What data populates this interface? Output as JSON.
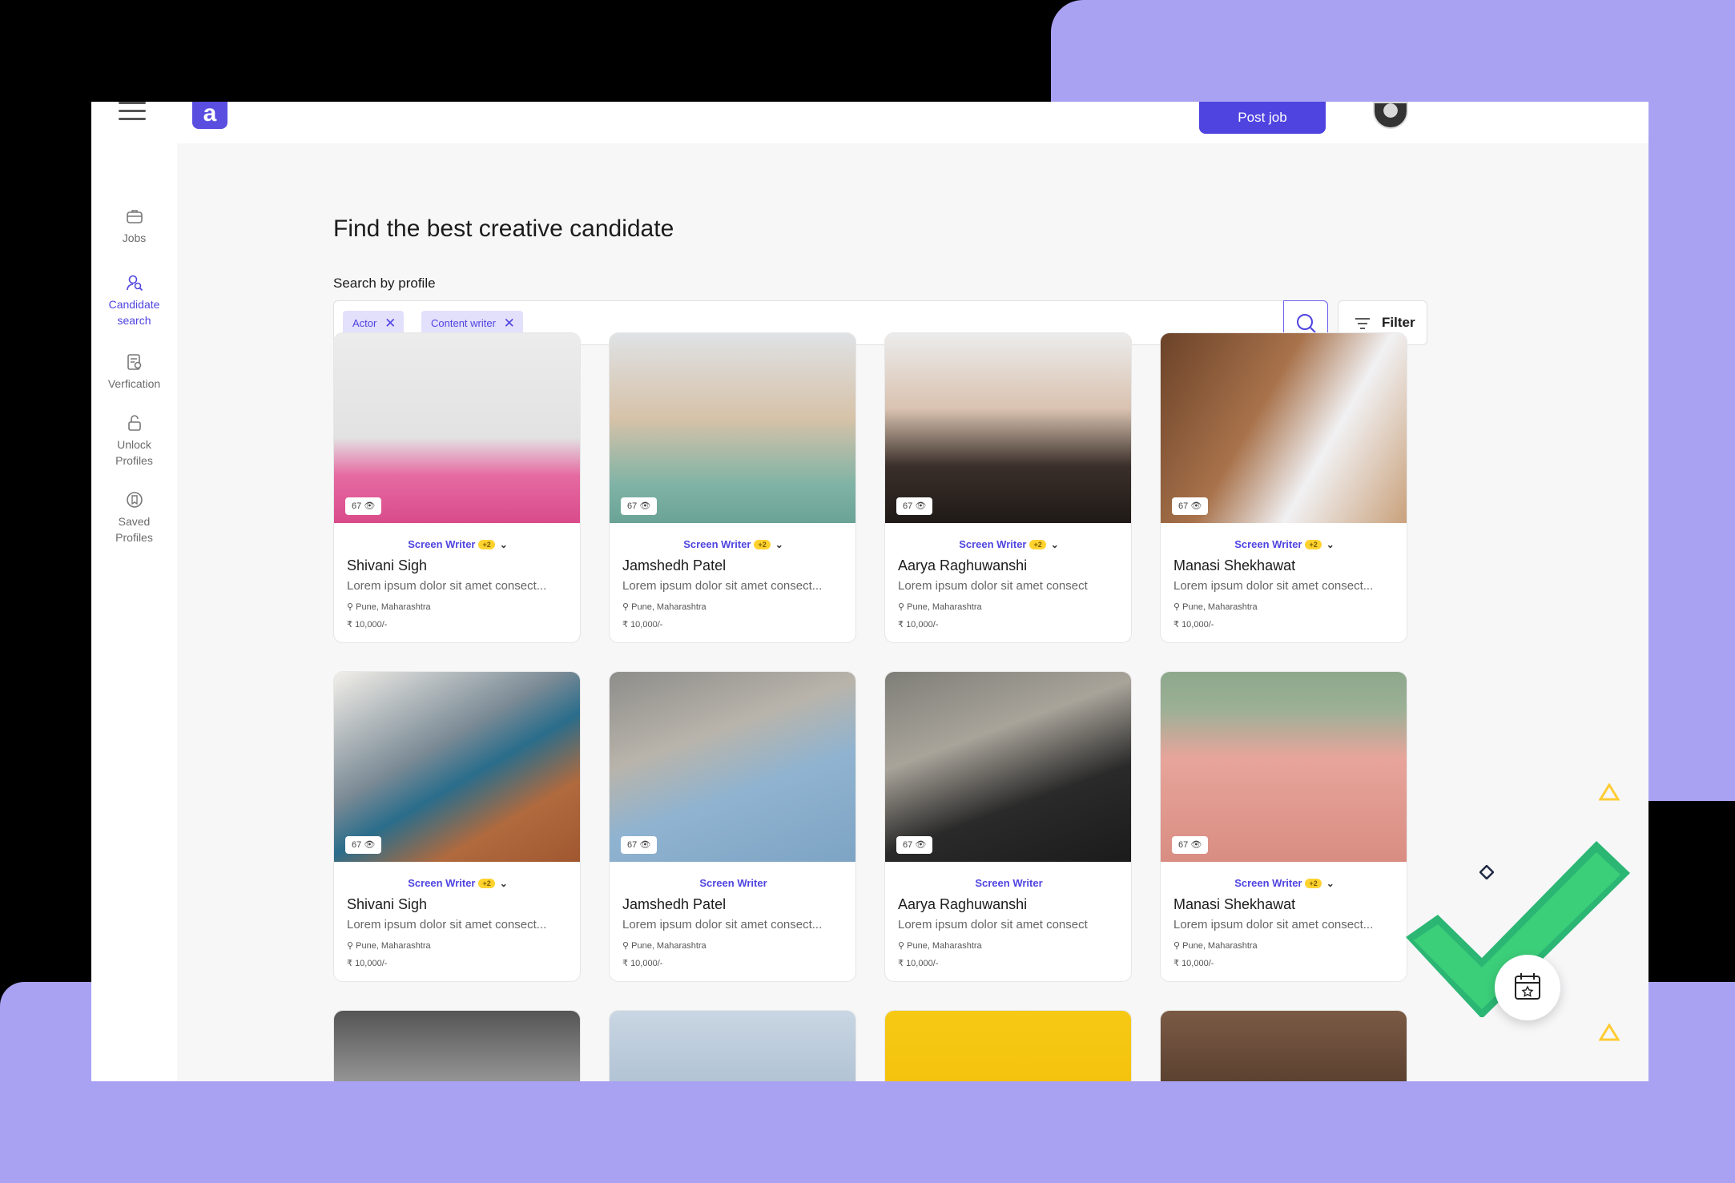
{
  "header": {
    "logo_letter": "a",
    "post_job_label": "Post job"
  },
  "sidebar": {
    "items": [
      {
        "label": "Jobs",
        "icon": "briefcase-icon",
        "active": false
      },
      {
        "label": "Candidate search",
        "icon": "person-search-icon",
        "active": true
      },
      {
        "label": "Verfication",
        "icon": "document-check-icon",
        "active": false
      },
      {
        "label": "Unlock Profiles",
        "icon": "unlock-icon",
        "active": false
      },
      {
        "label": "Saved Profiles",
        "icon": "bookmark-icon",
        "active": false
      }
    ]
  },
  "main": {
    "title": "Find the best creative candidate",
    "search_label": "Search by profile",
    "chips": [
      "Actor",
      "Content writer"
    ],
    "filter_label": "Filter"
  },
  "cards": [
    {
      "views": "67",
      "role": "Screen Writer",
      "extra": "+2",
      "name": "Shivani Sigh",
      "desc": "Lorem ipsum dolor sit amet consect...",
      "location": "Pune, Maharashtra",
      "pay": "10,000/-"
    },
    {
      "views": "67",
      "role": "Screen Writer",
      "extra": "+2",
      "name": "Jamshedh Patel",
      "desc": "Lorem ipsum dolor sit amet consect...",
      "location": "Pune, Maharashtra",
      "pay": "10,000/-"
    },
    {
      "views": "67",
      "role": "Screen Writer",
      "extra": "+2",
      "name": "Aarya Raghuwanshi",
      "desc": "Lorem ipsum dolor sit amet consect",
      "location": "Pune, Maharashtra",
      "pay": "10,000/-"
    },
    {
      "views": "67",
      "role": "Screen Writer",
      "extra": "+2",
      "name": "Manasi Shekhawat",
      "desc": "Lorem ipsum dolor sit amet consect...",
      "location": "Pune, Maharashtra",
      "pay": "10,000/-"
    },
    {
      "views": "67",
      "role": "Screen Writer",
      "extra": "+2",
      "name": "Shivani Sigh",
      "desc": "Lorem ipsum dolor sit amet consect...",
      "location": "Pune, Maharashtra",
      "pay": "10,000/-"
    },
    {
      "views": "67",
      "role": "Screen Writer",
      "extra": "",
      "name": "Jamshedh Patel",
      "desc": "Lorem ipsum dolor sit amet consect...",
      "location": "Pune, Maharashtra",
      "pay": "10,000/-"
    },
    {
      "views": "67",
      "role": "Screen Writer",
      "extra": "",
      "name": "Aarya Raghuwanshi",
      "desc": "Lorem ipsum dolor sit amet consect",
      "location": "Pune, Maharashtra",
      "pay": "10,000/-"
    },
    {
      "views": "67",
      "role": "Screen Writer",
      "extra": "+2",
      "name": "Manasi Shekhawat",
      "desc": "Lorem ipsum dolor sit amet consect...",
      "location": "Pune, Maharashtra",
      "pay": "10,000/-"
    }
  ],
  "colors": {
    "accent": "#4f44e0",
    "accent_light": "#e3e0fb",
    "badge": "#ffd22e",
    "decor_purple": "#a9a2f3",
    "check_green": "#2bb673"
  }
}
